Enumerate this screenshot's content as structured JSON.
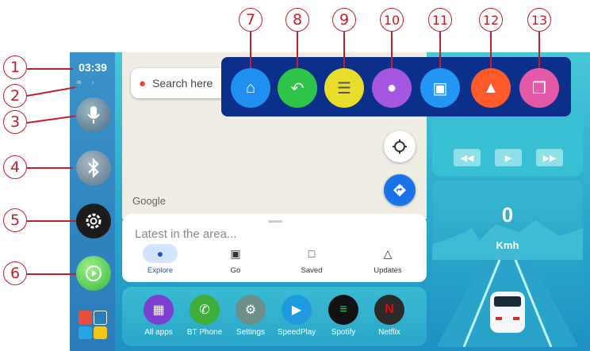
{
  "status": {
    "time": "03:39",
    "wifi_icon": "wifi-icon",
    "bluetooth_icon": "bluetooth-icon"
  },
  "callouts": [
    "1",
    "2",
    "3",
    "4",
    "5",
    "6",
    "7",
    "8",
    "9",
    "10",
    "11",
    "12",
    "13"
  ],
  "map": {
    "search_placeholder": "Search here",
    "attribution": "Google",
    "latest": "Latest in the area..."
  },
  "nav_tabs": [
    {
      "label": "Explore",
      "icon": "pin-icon"
    },
    {
      "label": "Go",
      "icon": "car-icon"
    },
    {
      "label": "Saved",
      "icon": "bookmark-icon"
    },
    {
      "label": "Updates",
      "icon": "bell-icon"
    }
  ],
  "dock_apps": [
    {
      "label": "All apps",
      "color": "#7b3fd1"
    },
    {
      "label": "BT Phone",
      "color": "#3fae3a"
    },
    {
      "label": "Settings",
      "color": "#6d8f8a"
    },
    {
      "label": "SpeedPlay",
      "color": "#1e9be0"
    },
    {
      "label": "Spotify",
      "color": "#1ed760"
    },
    {
      "label": "Netflix",
      "color": "#2a2a2a"
    }
  ],
  "speed": {
    "value": "0",
    "unit": "Kmh"
  },
  "popup_buttons": [
    {
      "name": "home",
      "color": "#1f8ff0"
    },
    {
      "name": "back",
      "color": "#2ec44a"
    },
    {
      "name": "clipboard",
      "color": "#e8dd2a"
    },
    {
      "name": "microphone",
      "color": "#a556e0"
    },
    {
      "name": "car-settings",
      "color": "#2196f3"
    },
    {
      "name": "rocket",
      "color": "#ff5a2a"
    },
    {
      "name": "windows",
      "color": "#e55aa8"
    }
  ]
}
